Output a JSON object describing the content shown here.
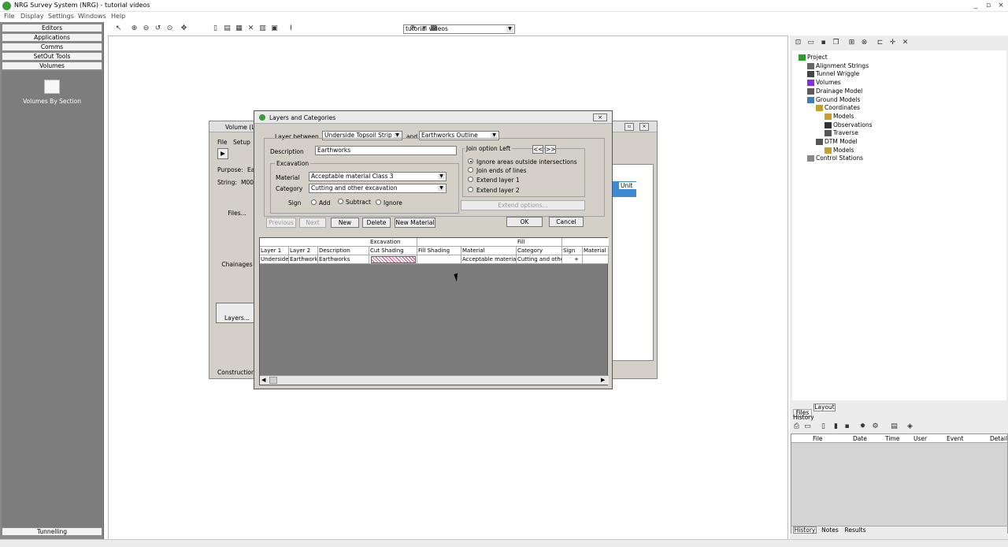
{
  "window": {
    "title": "NRG Survey System (NRG) - tutorial videos"
  },
  "menu": [
    "File",
    "Display",
    "Settings",
    "Windows",
    "Help"
  ],
  "left_panel": {
    "buttons": [
      "Editors",
      "Applications",
      "Comms",
      "SetOut Tools",
      "Volumes"
    ],
    "tool_label": "Volumes By Section",
    "bottom_button": "Tunnelling"
  },
  "toolbar": {
    "combo_value": "tutorial videos"
  },
  "tree": [
    {
      "label": "Project",
      "indent": 0
    },
    {
      "label": "Alignment Strings",
      "indent": 1
    },
    {
      "label": "Tunnel Wriggle",
      "indent": 1
    },
    {
      "label": "Volumes",
      "indent": 1
    },
    {
      "label": "Drainage Model",
      "indent": 1
    },
    {
      "label": "Ground Models",
      "indent": 1
    },
    {
      "label": "Coordinates",
      "indent": 2
    },
    {
      "label": "Models",
      "indent": 3
    },
    {
      "label": "Observations",
      "indent": 3
    },
    {
      "label": "Traverse",
      "indent": 3
    },
    {
      "label": "DTM Model",
      "indent": 2
    },
    {
      "label": "Models",
      "indent": 3
    },
    {
      "label": "Control Stations",
      "indent": 1
    }
  ],
  "right_tabs": [
    "Files",
    "Layout"
  ],
  "history": {
    "label": "History",
    "columns": [
      "File",
      "Date",
      "Time",
      "User",
      "Event",
      "Detail"
    ],
    "tabs": [
      "History",
      "Notes",
      "Results"
    ]
  },
  "volume_window": {
    "title": "Volume (L",
    "menu": [
      "File",
      "Setup"
    ],
    "purpose_label": "Purpose:",
    "purpose_value": "Ea",
    "string_label": "String:",
    "string_value": "M00",
    "unit_header": "Unit",
    "side_buttons": [
      "Files...",
      "Chainages",
      "Layers...",
      "Construction..."
    ]
  },
  "dialog": {
    "title": "Layers and Categories",
    "layer_between_label": "Layer between",
    "layer1_value": "Underside Topsoil Strip",
    "and_label": "and",
    "layer2_value": "Earthworks Outline",
    "description_label": "Description",
    "description_value": "Earthworks",
    "excavation_group": "Excavation",
    "material_label": "Material",
    "material_value": "Acceptable material Class 3",
    "category_label": "Category",
    "category_value": "Cutting and other excavation",
    "sign_label": "Sign",
    "sign_options": [
      "Add",
      "Subtract",
      "Ignore"
    ],
    "join_group": "Join option Left",
    "nav_prev": "<<",
    "nav_next": ">>",
    "join_options": [
      "Ignore areas outside intersections",
      "Join ends of lines",
      "Extend layer 1",
      "Extend layer 2"
    ],
    "extend_options": "Extend options...",
    "buttons": {
      "previous": "Previous",
      "next": "Next",
      "new": "New",
      "delete": "Delete",
      "new_material": "New Material",
      "ok": "OK",
      "cancel": "Cancel"
    },
    "grid": {
      "group_headers": {
        "excavation": "Excavation",
        "fill": "Fill"
      },
      "columns": [
        "Layer 1",
        "Layer 2",
        "Description",
        "Cut Shading",
        "Fill Shading",
        "Material",
        "Category",
        "Sign",
        "Material"
      ],
      "row": [
        "Underside",
        "Earthwork",
        "Earthworks",
        "",
        "",
        "Acceptable material C",
        "Cutting and other",
        "+",
        ""
      ]
    }
  }
}
